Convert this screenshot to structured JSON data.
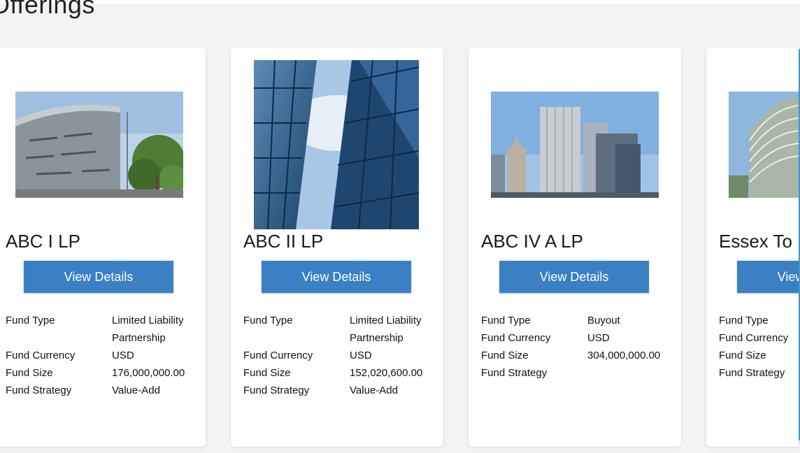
{
  "page": {
    "title": "Offerings"
  },
  "cards": [
    {
      "name": "ABC I LP",
      "button": "View Details",
      "labels": {
        "type": "Fund Type",
        "currency": "Fund Currency",
        "size": "Fund Size",
        "strategy": "Fund Strategy"
      },
      "values": {
        "type": "Limited Liability Partnership",
        "currency": "USD",
        "size": "176,000,000.00",
        "strategy": "Value-Add"
      }
    },
    {
      "name": "ABC II LP",
      "button": "View Details",
      "labels": {
        "type": "Fund Type",
        "currency": "Fund Currency",
        "size": "Fund Size",
        "strategy": "Fund Strategy"
      },
      "values": {
        "type": "Limited Liability Partnership",
        "currency": "USD",
        "size": "152,020,600.00",
        "strategy": "Value-Add"
      }
    },
    {
      "name": "ABC IV A LP",
      "button": "View Details",
      "labels": {
        "type": "Fund Type",
        "currency": "Fund Currency",
        "size": "Fund Size",
        "strategy": "Fund Strategy"
      },
      "values": {
        "type": "Buyout",
        "currency": "USD",
        "size": "304,000,000.00",
        "strategy": ""
      }
    },
    {
      "name": "Essex To",
      "button": "View Details",
      "labels": {
        "type": "Fund Type",
        "currency": "Fund Currency",
        "size": "Fund Size",
        "strategy": "Fund Strategy"
      },
      "values": {
        "type": "",
        "currency": "",
        "size": "",
        "strategy": ""
      }
    }
  ],
  "colors": {
    "button": "#3a80c3",
    "accent_edge": "#4a9bd6"
  }
}
